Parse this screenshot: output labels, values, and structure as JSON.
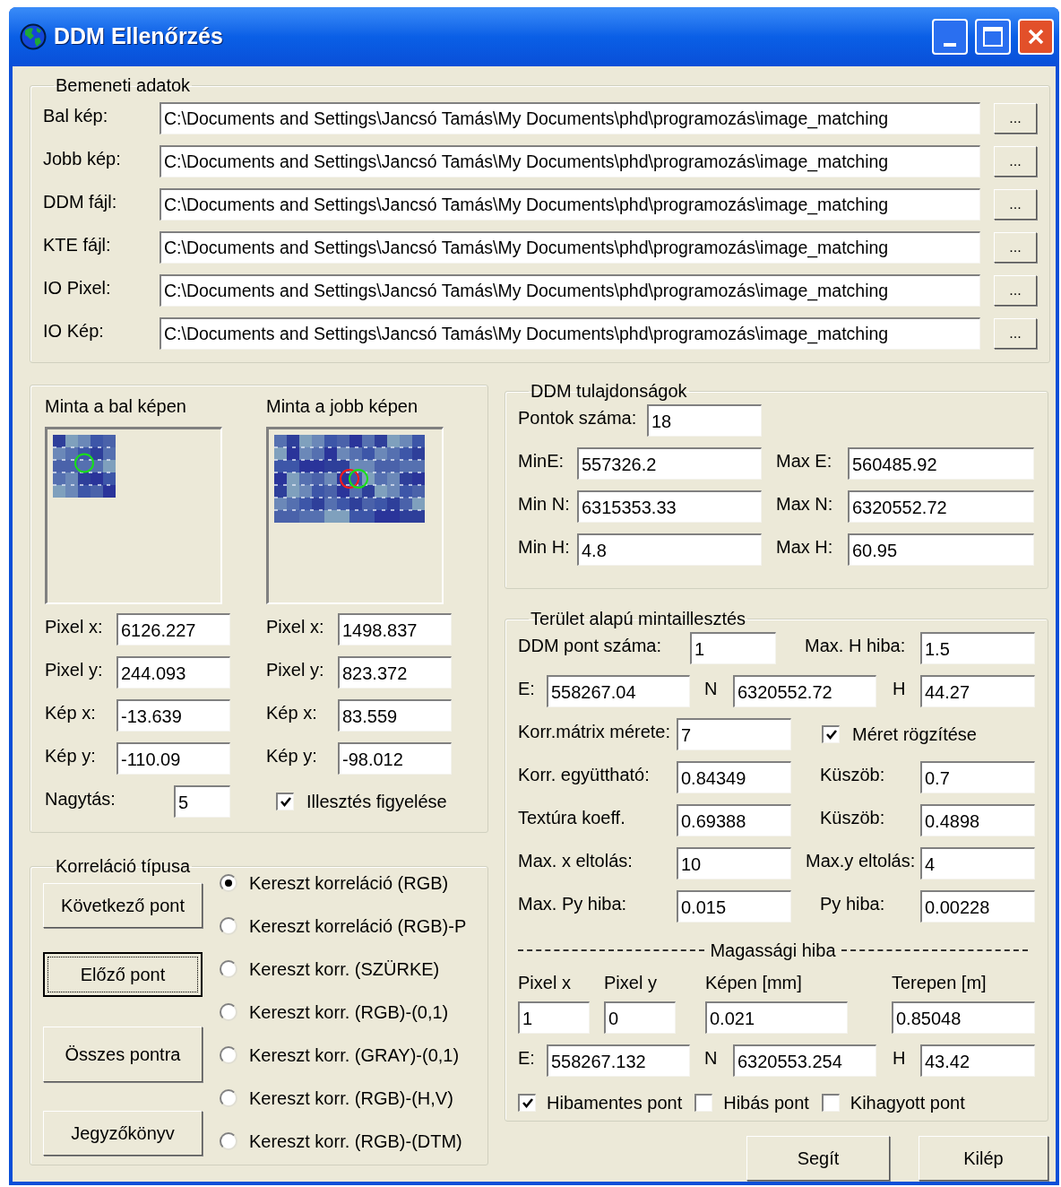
{
  "window": {
    "title": "DDM Ellenőrzés"
  },
  "input_data": {
    "title": "Bemeneti adatok",
    "rows": [
      {
        "label": "Bal kép:",
        "value": "C:\\Documents and Settings\\Jancsó Tamás\\My Documents\\phd\\programozás\\image_matching",
        "button": "..."
      },
      {
        "label": "Jobb kép:",
        "value": "C:\\Documents and Settings\\Jancsó Tamás\\My Documents\\phd\\programozás\\image_matching",
        "button": "..."
      },
      {
        "label": "DDM fájl:",
        "value": "C:\\Documents and Settings\\Jancsó Tamás\\My Documents\\phd\\programozás\\image_matching",
        "button": "..."
      },
      {
        "label": "KTE fájl:",
        "value": "C:\\Documents and Settings\\Jancsó Tamás\\My Documents\\phd\\programozás\\image_matching",
        "button": "..."
      },
      {
        "label": "IO Pixel:",
        "value": "C:\\Documents and Settings\\Jancsó Tamás\\My Documents\\phd\\programozás\\image_matching",
        "button": "..."
      },
      {
        "label": "IO Kép:",
        "value": "C:\\Documents and Settings\\Jancsó Tamás\\My Documents\\phd\\programozás\\image_matching",
        "button": "..."
      }
    ]
  },
  "samples": [
    {
      "title": "Minta a bal képen",
      "fields": [
        {
          "label": "Pixel x:",
          "value": "6126.227"
        },
        {
          "label": "Pixel y:",
          "value": "244.093"
        },
        {
          "label": "Kép x:",
          "value": "-13.639"
        },
        {
          "label": "Kép y:",
          "value": "-110.09"
        }
      ]
    },
    {
      "title": "Minta a jobb képen",
      "fields": [
        {
          "label": "Pixel x:",
          "value": "1498.837"
        },
        {
          "label": "Pixel y:",
          "value": "823.372"
        },
        {
          "label": "Kép x:",
          "value": "83.559"
        },
        {
          "label": "Kép y:",
          "value": "-98.012"
        }
      ]
    }
  ],
  "zoom": {
    "label": "Nagytás:",
    "value": "5"
  },
  "watch_match": {
    "label": "Illesztés figyelése",
    "checked": true
  },
  "correlation": {
    "title": "Korreláció típusa",
    "buttons": [
      {
        "label": "Következő pont",
        "focused": false
      },
      {
        "label": "Előző pont",
        "focused": true
      },
      {
        "label": "Összes pontra",
        "focused": false
      },
      {
        "label": "Jegyzőkönyv",
        "focused": false
      }
    ],
    "options": [
      {
        "label": "Kereszt korreláció (RGB)",
        "selected": true
      },
      {
        "label": "Kereszt korreláció (RGB)-P",
        "selected": false
      },
      {
        "label": "Kereszt korr. (SZÜRKE)",
        "selected": false
      },
      {
        "label": "Kereszt korr. (RGB)-(0,1)",
        "selected": false
      },
      {
        "label": "Kereszt korr. (GRAY)-(0,1)",
        "selected": false
      },
      {
        "label": "Kereszt korr. (RGB)-(H,V)",
        "selected": false
      },
      {
        "label": "Kereszt korr. (RGB)-(DTM)",
        "selected": false
      }
    ]
  },
  "ddm_properties": {
    "title": "DDM tulajdonságok",
    "point_count": {
      "label": "Pontok száma:",
      "value": "18"
    },
    "pairs": [
      [
        {
          "label": "MinE:",
          "value": "557326.2"
        },
        {
          "label": "Max E:",
          "value": "560485.92"
        }
      ],
      [
        {
          "label": "Min N:",
          "value": "6315353.33"
        },
        {
          "label": "Max N:",
          "value": "6320552.72"
        }
      ],
      [
        {
          "label": "Min H:",
          "value": "4.8"
        },
        {
          "label": "Max H:",
          "value": "60.95"
        }
      ]
    ]
  },
  "area_matching": {
    "title": "Terület alapú mintaillesztés",
    "ddm_point": {
      "label": "DDM pont száma:",
      "value": "1"
    },
    "max_h_error": {
      "label": "Max. H hiba:",
      "value": "1.5"
    },
    "coords": [
      {
        "label": "E:",
        "value": "558267.04"
      },
      {
        "label": "N",
        "value": "6320552.72"
      },
      {
        "label": "H",
        "value": "44.27"
      }
    ],
    "matrix_size": {
      "label": "Korr.mátrix mérete:",
      "value": "7"
    },
    "fix_size": {
      "label": "Méret rögzítése",
      "checked": true
    },
    "pairs": [
      [
        {
          "label": "Korr. együttható:",
          "value": "0.84349"
        },
        {
          "label": "Küszöb:",
          "value": "0.7"
        }
      ],
      [
        {
          "label": "Textúra koeff.",
          "value": "0.69388"
        },
        {
          "label": "Küszöb:",
          "value": "0.4898"
        }
      ],
      [
        {
          "label": "Max. x eltolás:",
          "value": "10"
        },
        {
          "label": "Max.y eltolás:",
          "value": "4"
        }
      ],
      [
        {
          "label": "Max. Py hiba:",
          "value": "0.015"
        },
        {
          "label": "Py hiba:",
          "value": "0.00228"
        }
      ]
    ],
    "height_error": {
      "title": "Magassági hiba",
      "columns": [
        {
          "label": "Pixel x",
          "value": "1"
        },
        {
          "label": "Pixel y",
          "value": "0"
        },
        {
          "label": "Képen  [mm]",
          "value": "0.021"
        },
        {
          "label": "Terepen [m]",
          "value": "0.85048"
        }
      ],
      "coords": [
        {
          "label": "E:",
          "value": "558267.132"
        },
        {
          "label": "N",
          "value": "6320553.254"
        },
        {
          "label": "H",
          "value": "43.42"
        }
      ],
      "checks": [
        {
          "label": "Hibamentes pont",
          "checked": true
        },
        {
          "label": "Hibás pont",
          "checked": false
        },
        {
          "label": "Kihagyott pont",
          "checked": false
        }
      ]
    }
  },
  "footer_buttons": [
    "Segít",
    "Kilép"
  ]
}
